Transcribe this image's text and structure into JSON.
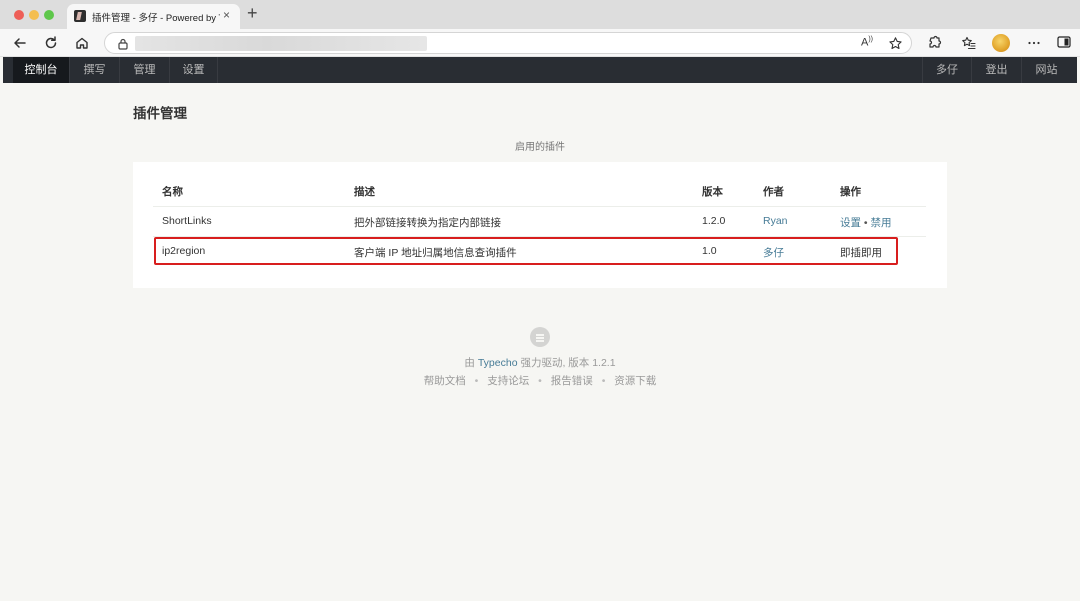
{
  "browser": {
    "tab_title": "插件管理 - 多仔 - Powered by Typecho",
    "tab_close": "×",
    "new_tab": "+",
    "read_aloud_label": "A"
  },
  "nav": {
    "left": [
      "控制台",
      "撰写",
      "管理",
      "设置"
    ],
    "active": "控制台",
    "right": [
      "多仔",
      "登出",
      "网站"
    ]
  },
  "page": {
    "title": "插件管理",
    "section_title": "启用的插件"
  },
  "table": {
    "columns": [
      "名称",
      "描述",
      "版本",
      "作者",
      "操作"
    ],
    "rows": [
      {
        "name": "ShortLinks",
        "description": "把外部链接转换为指定内部链接",
        "version": "1.2.0",
        "author": "Ryan",
        "action_settings": "设置",
        "action_sep": "•",
        "action_disable": "禁用"
      },
      {
        "name": "ip2region",
        "description": "客户端 IP 地址归属地信息查询插件",
        "version": "1.0",
        "author": "多仔",
        "action": "即插即用"
      }
    ]
  },
  "footer": {
    "prefix": "由 ",
    "brand": "Typecho",
    "suffix": " 强力驱动, 版本 1.2.1",
    "links": [
      "帮助文档",
      "支持论坛",
      "报告错误",
      "资源下载"
    ],
    "separator": "•"
  },
  "colors": {
    "accent_link": "#467b96",
    "nav_background": "#292d33",
    "highlight_border": "#d81e1e"
  }
}
